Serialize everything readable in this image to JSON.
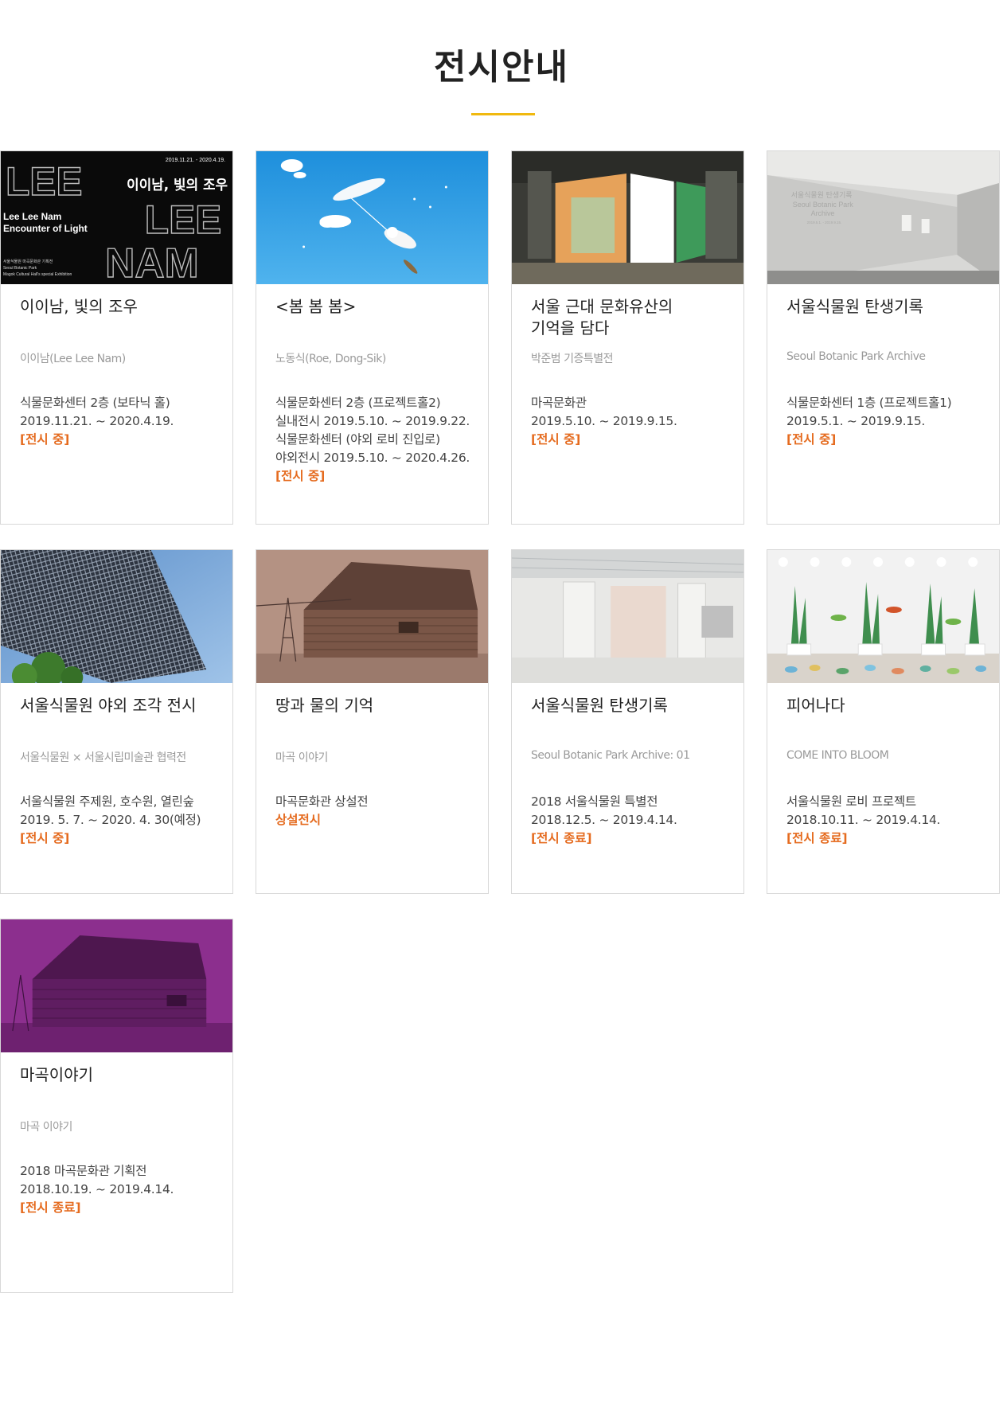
{
  "page": {
    "title": "전시안내"
  },
  "colors": {
    "accent_underline": "#f0b90f",
    "status": "#e56b1f"
  },
  "cards": [
    {
      "thumb": {
        "date": "2019.11.21. - 2020.4.19.",
        "heading": "이이남, 빛의 조우",
        "big1": "LEE",
        "big2": "LEE",
        "big3": "NAM",
        "name_en_1": "Lee Lee Nam",
        "name_en_2": "Encounter of Light",
        "credit1": "서울식물원 마곡문화관 기획전",
        "credit2": "Seoul Botanic Park",
        "credit3": "Magok Cultural Hall's special Exhibition"
      },
      "title": "이이남, 빛의 조우",
      "subtitle": "이이남(Lee Lee Nam)",
      "details": [
        "식물문화센터 2층 (보타닉 홀)",
        "2019.11.21. ~ 2020.4.19."
      ],
      "status": "[전시 중]"
    },
    {
      "title": "<봄 봄 봄>",
      "subtitle": "노동식(Roe, Dong-Sik)",
      "details": [
        "식물문화센터 2층 (프로젝트홀2)",
        "실내전시 2019.5.10. ~ 2019.9.22.",
        "식물문화센터 (야외 로비 진입로)",
        "야외전시 2019.5.10. ~ 2020.4.26."
      ],
      "status": "[전시 중]"
    },
    {
      "title_line1": "서울 근대 문화유산의",
      "title_line2": "기억을 담다",
      "subtitle": "박준범 기증특별전",
      "details": [
        "마곡문화관",
        "2019.5.10. ~ 2019.9.15."
      ],
      "status": "[전시 중]"
    },
    {
      "thumb": {
        "wall1": "서울식물원 탄생기록",
        "wall2": "Seoul Botanic Park",
        "wall3": "Archive",
        "wall4": "2019.5.1. - 2019.9.15."
      },
      "title": "서울식물원 탄생기록",
      "subtitle": "Seoul Botanic Park Archive",
      "details": [
        "식물문화센터 1층 (프로젝트홀1)",
        "2019.5.1. ~ 2019.9.15."
      ],
      "status": "[전시 중]"
    },
    {
      "title": "서울식물원 야외 조각 전시",
      "subtitle": "서울식물원 × 서울시립미술관 협력전",
      "details": [
        "서울식물원 주제원, 호수원, 열린숲",
        "2019. 5. 7. ~ 2020. 4. 30(예정)"
      ],
      "status": "[전시 중]"
    },
    {
      "title": "땅과 물의 기억",
      "subtitle": "마곡 이야기",
      "details": [
        "마곡문화관 상설전"
      ],
      "status": "상설전시"
    },
    {
      "title": "서울식물원 탄생기록",
      "subtitle": "Seoul Botanic Park Archive: 01",
      "details": [
        "2018 서울식물원 특별전",
        "2018.12.5. ~ 2019.4.14."
      ],
      "status": "[전시 종료]"
    },
    {
      "title": "피어나다",
      "subtitle": "COME INTO BLOOM",
      "details": [
        "서울식물원 로비 프로젝트",
        "2018.10.11. ~ 2019.4.14."
      ],
      "status": "[전시 종료]"
    },
    {
      "title": "마곡이야기",
      "subtitle": "마곡 이야기",
      "details": [
        "2018 마곡문화관 기획전",
        "2018.10.19. ~ 2019.4.14."
      ],
      "status": "[전시 종료]"
    }
  ]
}
